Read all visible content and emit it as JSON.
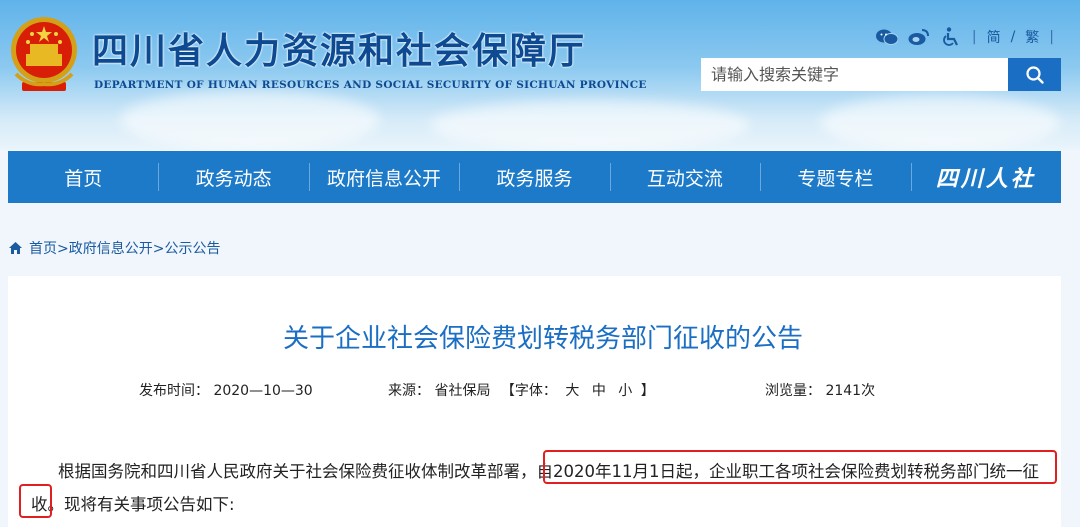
{
  "header": {
    "title_cn": "四川省人力资源和社会保障厅",
    "title_en": "DEPARTMENT OF HUMAN RESOURCES AND SOCIAL SECURITY OF SICHUAN PROVINCE",
    "lang_simplified": "简",
    "lang_separator": "/",
    "lang_traditional": "繁",
    "icons": [
      "wechat-icon",
      "weibo-icon",
      "accessibility-icon"
    ]
  },
  "search": {
    "placeholder": "请输入搜索关键字"
  },
  "nav": {
    "items": [
      "首页",
      "政务动态",
      "政府信息公开",
      "政务服务",
      "互动交流",
      "专题专栏"
    ],
    "logo_text": "四川人社"
  },
  "breadcrumb": {
    "text": "首页>政府信息公开>公示公告"
  },
  "article": {
    "title": "关于企业社会保险费划转税务部门征收的公告",
    "publish_label": "发布时间：",
    "publish_date": "2020—10—30",
    "source_label": "来源：",
    "source": "省社保局",
    "font_label": "【字体：",
    "font_large": "大",
    "font_medium": "中",
    "font_small": "小",
    "font_close": "】",
    "views_label": "浏览量：",
    "views": "2141次",
    "para_part1": "根据国务院和四川省人民政府关于社会保险费征收体制改革部署，",
    "para_part2": "自2020年11月1日起，企业职工各项社会保险费划转税务部门统一征",
    "para_line2_hl": "收。",
    "para_line2_rest": "现将有关事项公告如下:"
  },
  "colors": {
    "brand_blue": "#1c7ac8",
    "title_blue": "#1a6ec3",
    "highlight_red": "#e02020"
  }
}
